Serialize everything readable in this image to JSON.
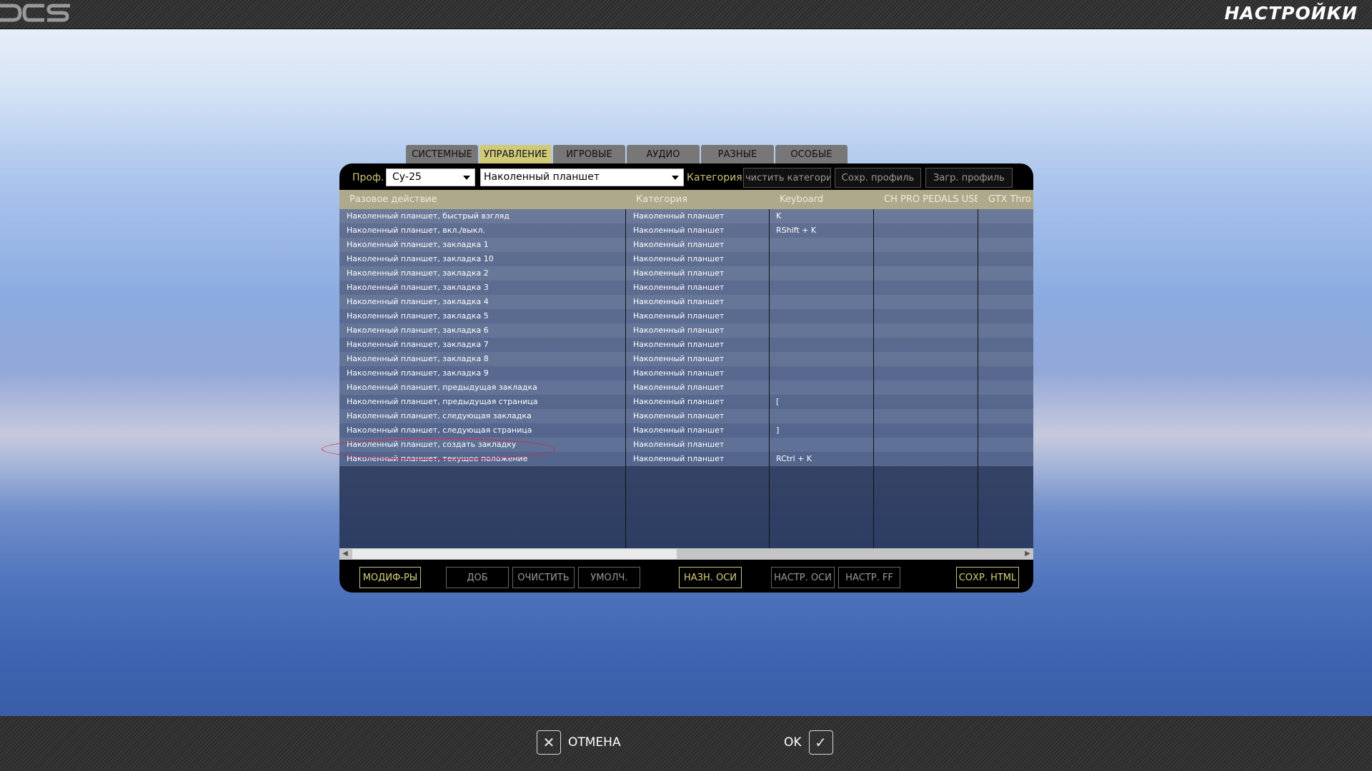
{
  "window": {
    "title": "НАСТРОЙКИ",
    "logo_text": "DCS"
  },
  "tabs": [
    {
      "label": "СИСТЕМНЫЕ",
      "active": false
    },
    {
      "label": "УПРАВЛЕНИЕ",
      "active": true
    },
    {
      "label": "ИГРОВЫЕ",
      "active": false
    },
    {
      "label": "АУДИО",
      "active": false
    },
    {
      "label": "РАЗНЫЕ",
      "active": false
    },
    {
      "label": "ОСОБЫЕ",
      "active": false
    }
  ],
  "toolbar": {
    "profile_label": "Проф.",
    "profile_value": "Су-25",
    "category_select_value": "Наколенный планшет",
    "category_label": "Категория",
    "clear_category": "чистить категори",
    "save_profile": "Сохр. профиль",
    "load_profile": "Загр. профиль"
  },
  "table": {
    "headers": [
      "Разовое действие",
      "Категория",
      "Keyboard",
      "CH PRO PEDALS USE",
      "GTX Thro"
    ],
    "rows": [
      {
        "action": "Наколенный планшет, быстрый взгляд",
        "category": "Наколенный планшет",
        "keyboard": "K"
      },
      {
        "action": "Наколенный планшет, вкл./выкл.",
        "category": "Наколенный планшет",
        "keyboard": "RShift + K"
      },
      {
        "action": "Наколенный планшет, закладка 1",
        "category": "Наколенный планшет",
        "keyboard": ""
      },
      {
        "action": "Наколенный планшет, закладка 10",
        "category": "Наколенный планшет",
        "keyboard": ""
      },
      {
        "action": "Наколенный планшет, закладка 2",
        "category": "Наколенный планшет",
        "keyboard": ""
      },
      {
        "action": "Наколенный планшет, закладка 3",
        "category": "Наколенный планшет",
        "keyboard": ""
      },
      {
        "action": "Наколенный планшет, закладка 4",
        "category": "Наколенный планшет",
        "keyboard": ""
      },
      {
        "action": "Наколенный планшет, закладка 5",
        "category": "Наколенный планшет",
        "keyboard": ""
      },
      {
        "action": "Наколенный планшет, закладка 6",
        "category": "Наколенный планшет",
        "keyboard": ""
      },
      {
        "action": "Наколенный планшет, закладка 7",
        "category": "Наколенный планшет",
        "keyboard": ""
      },
      {
        "action": "Наколенный планшет, закладка 8",
        "category": "Наколенный планшет",
        "keyboard": ""
      },
      {
        "action": "Наколенный планшет, закладка 9",
        "category": "Наколенный планшет",
        "keyboard": ""
      },
      {
        "action": "Наколенный планшет, предыдущая закладка",
        "category": "Наколенный планшет",
        "keyboard": ""
      },
      {
        "action": "Наколенный планшет, предыдущая страница",
        "category": "Наколенный планшет",
        "keyboard": "["
      },
      {
        "action": "Наколенный планшет, следующая закладка",
        "category": "Наколенный планшет",
        "keyboard": ""
      },
      {
        "action": "Наколенный планшет, следующая страница",
        "category": "Наколенный планшет",
        "keyboard": "]"
      },
      {
        "action": "Наколенный планшет, создать закладку",
        "category": "Наколенный планшет",
        "keyboard": ""
      },
      {
        "action": "Наколенный планшет, текущее положение",
        "category": "Наколенный планшет",
        "keyboard": "RCtrl + K"
      }
    ]
  },
  "actions": {
    "modifiers": "МОДИФ-РЫ",
    "add": "ДОБ",
    "clear": "ОЧИСТИТЬ",
    "default": "УМОЛЧ.",
    "assign_axis": "НАЗН. ОСИ",
    "axis_tune": "НАСТР. ОСИ",
    "ff_tune": "НАСТР. FF",
    "save_html": "СОХР. HTML"
  },
  "footer": {
    "cancel": "ОТМЕНА",
    "ok": "OK"
  },
  "colors": {
    "accent": "#c9c27a",
    "active_tab": "#cfc97a",
    "markup": "#d8254a"
  }
}
